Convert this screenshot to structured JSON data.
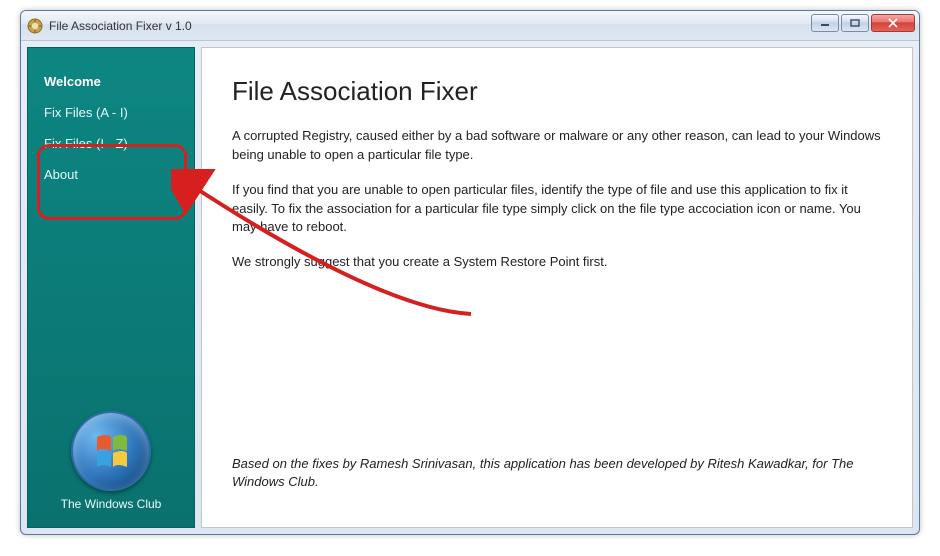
{
  "window": {
    "title": "File Association Fixer v 1.0"
  },
  "sidebar": {
    "items": [
      {
        "label": "Welcome",
        "active": true
      },
      {
        "label": "Fix Files (A - I)",
        "active": false
      },
      {
        "label": "Fix Files (I - Z)",
        "active": false
      },
      {
        "label": "About",
        "active": false
      }
    ],
    "brand": "The Windows Club"
  },
  "content": {
    "heading": "File Association Fixer",
    "para1": "A corrupted Registry, caused either by a bad software or malware or any other reason, can lead to your Windows being unable to open a particular file type.",
    "para2": "If you find that you are unable to open particular files, identify the type of file and use this application to fix it easily. To fix the association for a particular file type simply click on the file type accociation icon or name. You may have to reboot.",
    "para3": "We strongly suggest that you create a System Restore Point first.",
    "credit": "Based on the fixes by Ramesh Srinivasan, this application has been developed by Ritesh Kawadkar, for The Windows Club."
  },
  "annotation": {
    "highlight_targets": [
      "Fix Files (A - I)",
      "Fix Files (I - Z)"
    ],
    "arrow_color": "#d62020"
  }
}
